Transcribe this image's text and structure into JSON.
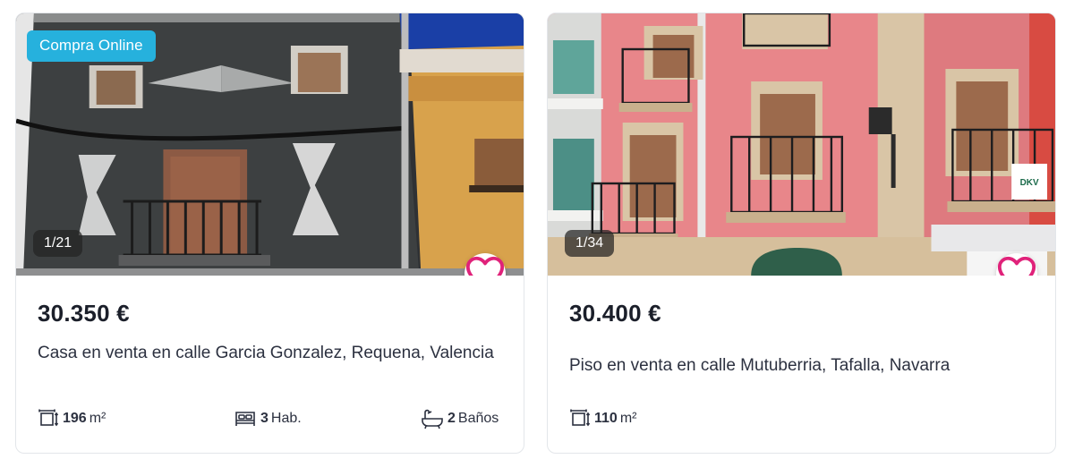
{
  "listings": [
    {
      "badge": "Compra Online",
      "photo_counter": "1/21",
      "price": "30.350 €",
      "title": "Casa en venta en calle Garcia Gonzalez, Requena, Valencia",
      "features": {
        "area_value": "196",
        "area_unit": "m²",
        "rooms_value": "3",
        "rooms_label": "Hab.",
        "baths_value": "2",
        "baths_label": "Baños"
      }
    },
    {
      "photo_counter": "1/34",
      "price": "30.400 €",
      "title": "Piso en venta en calle Mutuberria, Tafalla, Navarra",
      "features": {
        "area_value": "110",
        "area_unit": "m²"
      },
      "sign_text": "DKV"
    }
  ],
  "colors": {
    "badge_bg": "#26b1dd",
    "heart": "#e0227a",
    "facade_dark": "#3c3f40",
    "facade_pink": "#e8868a"
  },
  "icons": [
    "heart-icon",
    "area-icon",
    "bed-icon",
    "bathtub-icon"
  ]
}
